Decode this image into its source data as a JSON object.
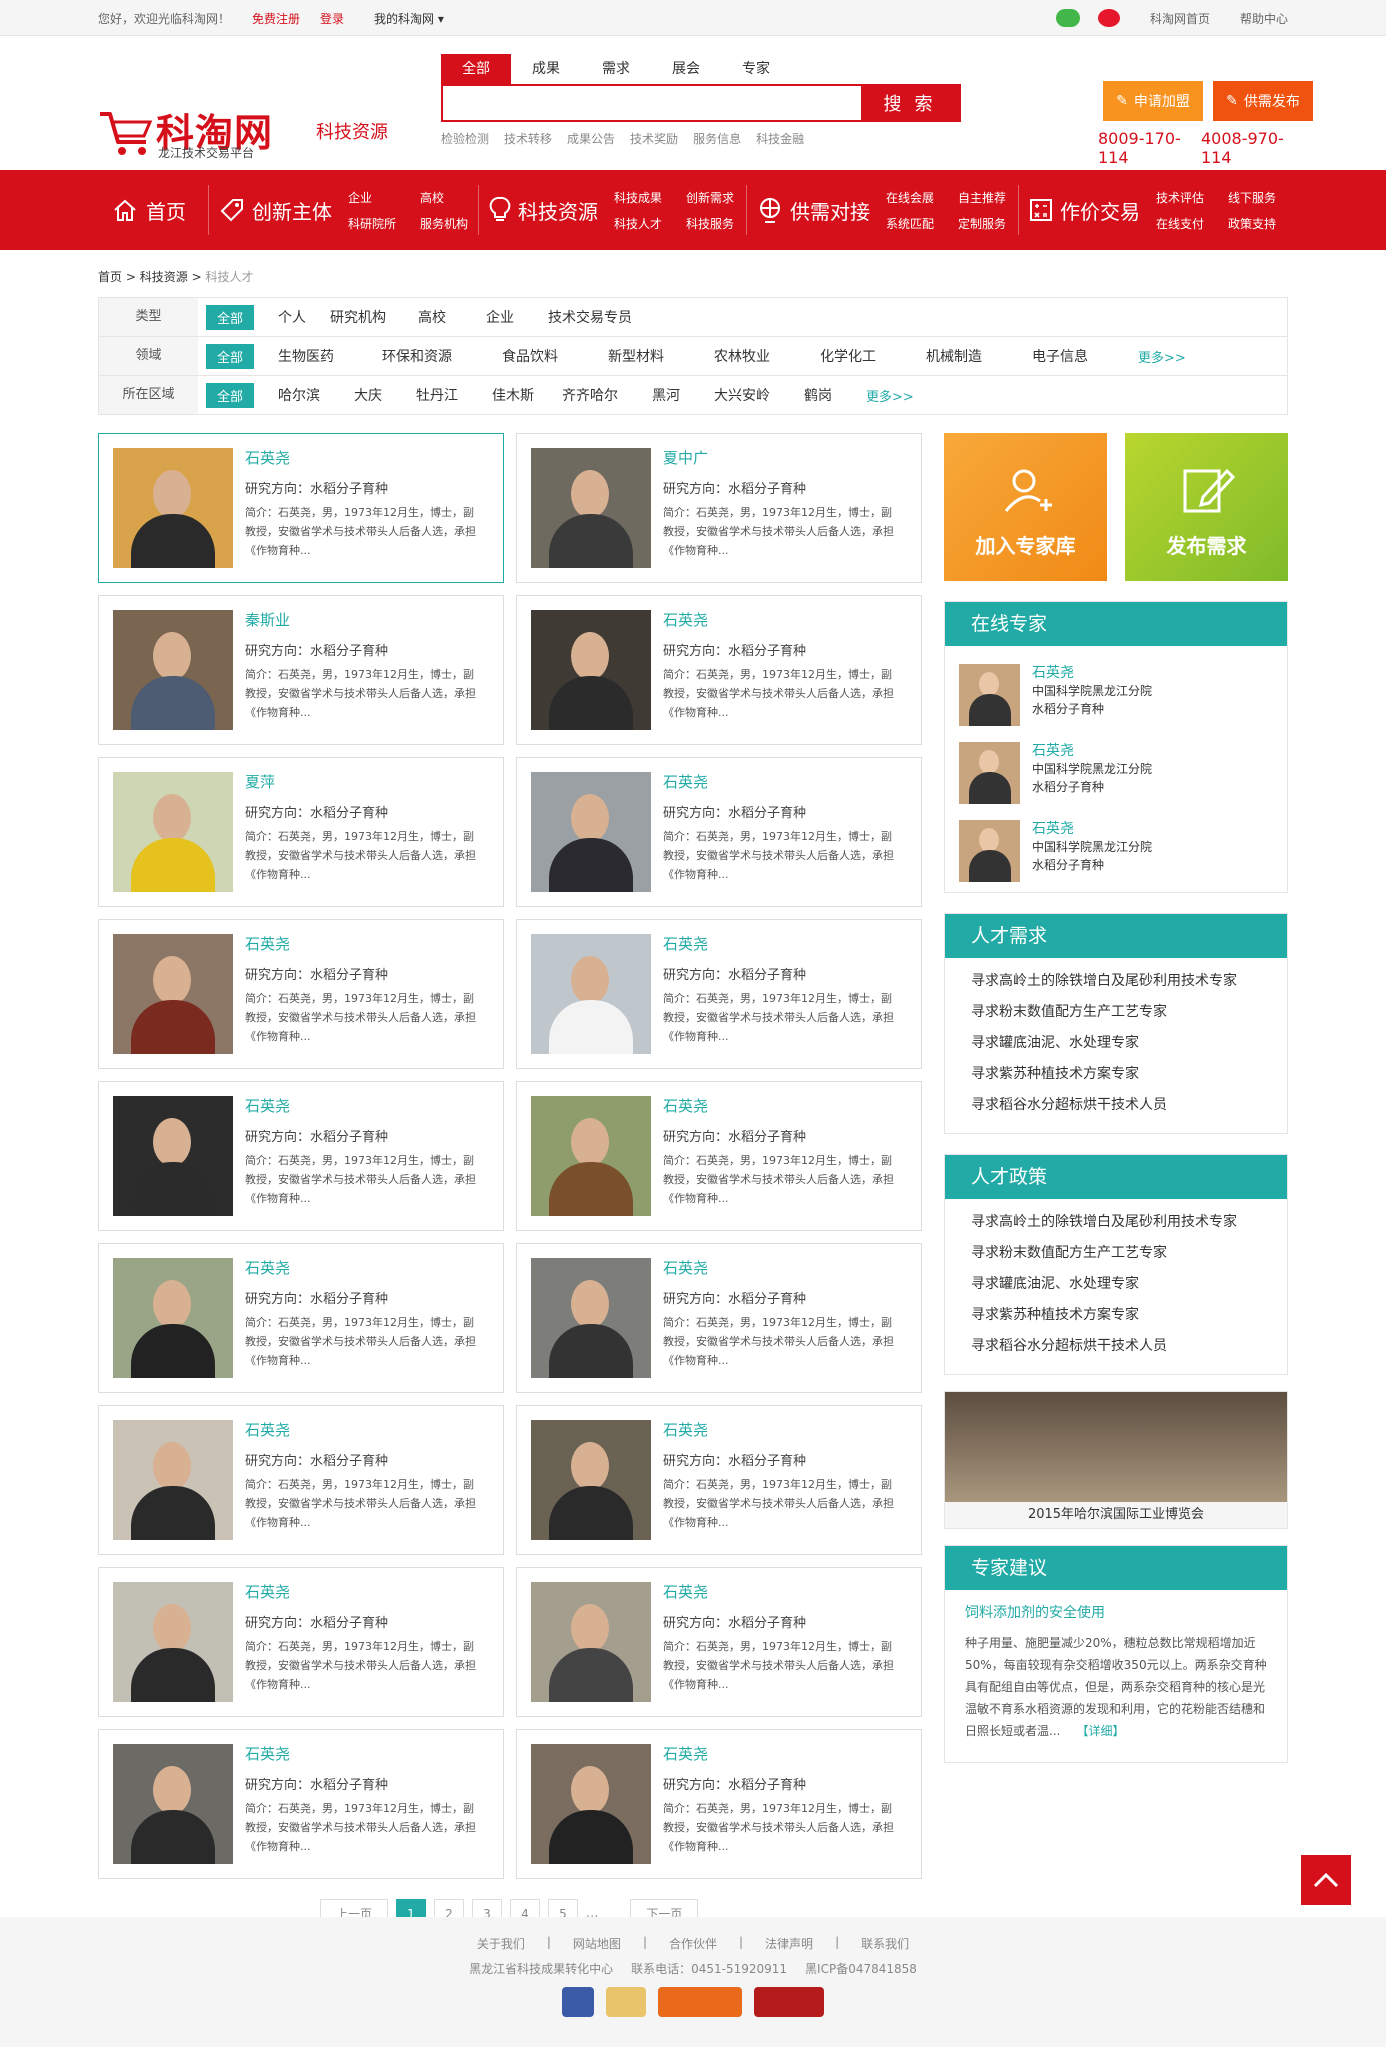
{
  "topbar": {
    "welcome": "您好，欢迎光临科淘网！",
    "register": "免费注册",
    "login": "登录",
    "my": "我的科淘网",
    "home": "科淘网首页",
    "help": "帮助中心"
  },
  "header": {
    "logo": "科淘网",
    "logo_sub": "龙江技术交易平台",
    "channel": "科技资源",
    "search_tabs": [
      "全部",
      "成果",
      "需求",
      "展会",
      "专家"
    ],
    "search_placeholder": "",
    "search_btn": "搜 索",
    "hot": [
      "检验检测",
      "技术转移",
      "成果公告",
      "技术奖励",
      "服务信息",
      "科技金融"
    ],
    "btn_join": "申请加盟",
    "btn_publish": "供需发布",
    "phone1": "8009-170-114",
    "phone2": "4008-970-114"
  },
  "nav": {
    "home": "首页",
    "groups": [
      {
        "title": "创新主体",
        "subs": [
          "企业",
          "高校",
          "科研院所",
          "服务机构"
        ]
      },
      {
        "title": "科技资源",
        "subs": [
          "科技成果",
          "创新需求",
          "科技人才",
          "科技服务"
        ]
      },
      {
        "title": "供需对接",
        "subs": [
          "在线会展",
          "自主推荐",
          "系统匹配",
          "定制服务"
        ]
      },
      {
        "title": "作价交易",
        "subs": [
          "技术评估",
          "线下服务",
          "在线支付",
          "政策支持"
        ]
      }
    ]
  },
  "crumb": [
    "首页",
    "科技资源",
    "科技人才"
  ],
  "filters": [
    {
      "label": "类型",
      "opts": [
        "全部",
        "个人",
        "研究机构",
        "高校",
        "企业",
        "技术交易专员"
      ],
      "more": ""
    },
    {
      "label": "领域",
      "opts": [
        "全部",
        "生物医药",
        "环保和资源",
        "食品饮料",
        "新型材料",
        "农林牧业",
        "化学化工",
        "机械制造",
        "电子信息"
      ],
      "more": "更多>>"
    },
    {
      "label": "所在区域",
      "opts": [
        "全部",
        "哈尔滨",
        "大庆",
        "牡丹江",
        "佳木斯",
        "齐齐哈尔",
        "黑河",
        "大兴安岭",
        "鹤岗"
      ],
      "more": "更多>>"
    }
  ],
  "experts": [
    {
      "name": "石英尧",
      "dir": "研究方向：水稻分子育种",
      "bio": "简介：石英尧，男，1973年12月生，博士，副教授，安徽省学术与技术带头人后备人选，承担《作物育种..."
    },
    {
      "name": "夏中广",
      "dir": "研究方向：水稻分子育种",
      "bio": "简介：石英尧，男，1973年12月生，博士，副教授，安徽省学术与技术带头人后备人选，承担《作物育种..."
    },
    {
      "name": "秦斯业",
      "dir": "研究方向：水稻分子育种",
      "bio": "简介：石英尧，男，1973年12月生，博士，副教授，安徽省学术与技术带头人后备人选，承担《作物育种..."
    },
    {
      "name": "石英尧",
      "dir": "研究方向：水稻分子育种",
      "bio": "简介：石英尧，男，1973年12月生，博士，副教授，安徽省学术与技术带头人后备人选，承担《作物育种..."
    },
    {
      "name": "夏萍",
      "dir": "研究方向：水稻分子育种",
      "bio": "简介：石英尧，男，1973年12月生，博士，副教授，安徽省学术与技术带头人后备人选，承担《作物育种..."
    },
    {
      "name": "石英尧",
      "dir": "研究方向：水稻分子育种",
      "bio": "简介：石英尧，男，1973年12月生，博士，副教授，安徽省学术与技术带头人后备人选，承担《作物育种..."
    },
    {
      "name": "石英尧",
      "dir": "研究方向：水稻分子育种",
      "bio": "简介：石英尧，男，1973年12月生，博士，副教授，安徽省学术与技术带头人后备人选，承担《作物育种..."
    },
    {
      "name": "石英尧",
      "dir": "研究方向：水稻分子育种",
      "bio": "简介：石英尧，男，1973年12月生，博士，副教授，安徽省学术与技术带头人后备人选，承担《作物育种..."
    },
    {
      "name": "石英尧",
      "dir": "研究方向：水稻分子育种",
      "bio": "简介：石英尧，男，1973年12月生，博士，副教授，安徽省学术与技术带头人后备人选，承担《作物育种..."
    },
    {
      "name": "石英尧",
      "dir": "研究方向：水稻分子育种",
      "bio": "简介：石英尧，男，1973年12月生，博士，副教授，安徽省学术与技术带头人后备人选，承担《作物育种..."
    },
    {
      "name": "石英尧",
      "dir": "研究方向：水稻分子育种",
      "bio": "简介：石英尧，男，1973年12月生，博士，副教授，安徽省学术与技术带头人后备人选，承担《作物育种..."
    },
    {
      "name": "石英尧",
      "dir": "研究方向：水稻分子育种",
      "bio": "简介：石英尧，男，1973年12月生，博士，副教授，安徽省学术与技术带头人后备人选，承担《作物育种..."
    },
    {
      "name": "石英尧",
      "dir": "研究方向：水稻分子育种",
      "bio": "简介：石英尧，男，1973年12月生，博士，副教授，安徽省学术与技术带头人后备人选，承担《作物育种..."
    },
    {
      "name": "石英尧",
      "dir": "研究方向：水稻分子育种",
      "bio": "简介：石英尧，男，1973年12月生，博士，副教授，安徽省学术与技术带头人后备人选，承担《作物育种..."
    },
    {
      "name": "石英尧",
      "dir": "研究方向：水稻分子育种",
      "bio": "简介：石英尧，男，1973年12月生，博士，副教授，安徽省学术与技术带头人后备人选，承担《作物育种..."
    },
    {
      "name": "石英尧",
      "dir": "研究方向：水稻分子育种",
      "bio": "简介：石英尧，男，1973年12月生，博士，副教授，安徽省学术与技术带头人后备人选，承担《作物育种..."
    },
    {
      "name": "石英尧",
      "dir": "研究方向：水稻分子育种",
      "bio": "简介：石英尧，男，1973年12月生，博士，副教授，安徽省学术与技术带头人后备人选，承担《作物育种..."
    },
    {
      "name": "石英尧",
      "dir": "研究方向：水稻分子育种",
      "bio": "简介：石英尧，男，1973年12月生，博士，副教授，安徽省学术与技术带头人后备人选，承担《作物育种..."
    }
  ],
  "pager": {
    "prev": "上一页",
    "pages": [
      "1",
      "2",
      "3",
      "4",
      "5"
    ],
    "ellipsis": "...",
    "next": "下一页"
  },
  "side": {
    "promo_join": "加入专家库",
    "promo_publish": "发布需求",
    "online_title": "在线专家",
    "online": [
      {
        "name": "石英尧",
        "org": "中国科学院黑龙江分院",
        "field": "水稻分子育种"
      },
      {
        "name": "石英尧",
        "org": "中国科学院黑龙江分院",
        "field": "水稻分子育种"
      },
      {
        "name": "石英尧",
        "org": "中国科学院黑龙江分院",
        "field": "水稻分子育种"
      }
    ],
    "demand_title": "人才需求",
    "demand": [
      "寻求高岭土的除铁增白及尾砂利用技术专家",
      "寻求粉末数值配方生产工艺专家",
      "寻求罐底油泥、水处理专家",
      "寻求紫苏种植技术方案专家",
      "寻求稻谷水分超标烘干技术人员"
    ],
    "policy_title": "人才政策",
    "policy": [
      "寻求高岭土的除铁增白及尾砂利用技术专家",
      "寻求粉末数值配方生产工艺专家",
      "寻求罐底油泥、水处理专家",
      "寻求紫苏种植技术方案专家",
      "寻求稻谷水分超标烘干技术人员"
    ],
    "expo_caption": "2015年哈尔滨国际工业博览会",
    "advice_title": "专家建议",
    "advice_head": "饲料添加剂的安全使用",
    "advice_text": "种子用量、施肥量减少20%，穗粒总数比常规稻增加近50%，每亩较现有杂交稻增收350元以上。两系杂交育种具有配组自由等优点，但是，两系杂交稻育种的核心是光温敏不育系水稻资源的发现和利用，它的花粉能否结穗和日照长短或者温...",
    "advice_more": "【详细】"
  },
  "footer": {
    "links": [
      "关于我们",
      "网站地图",
      "合作伙伴",
      "法律声明",
      "联系我们"
    ],
    "seps": [
      "|",
      "|",
      "|",
      "|"
    ],
    "org": "黑龙江省科技成果转化中心",
    "tel": "联系电话：0451-51920911",
    "icp": "黑ICP备047841858"
  },
  "colors": {
    "brand_red": "#d5101b",
    "teal": "#22aba6",
    "orange": "#f7931e"
  }
}
